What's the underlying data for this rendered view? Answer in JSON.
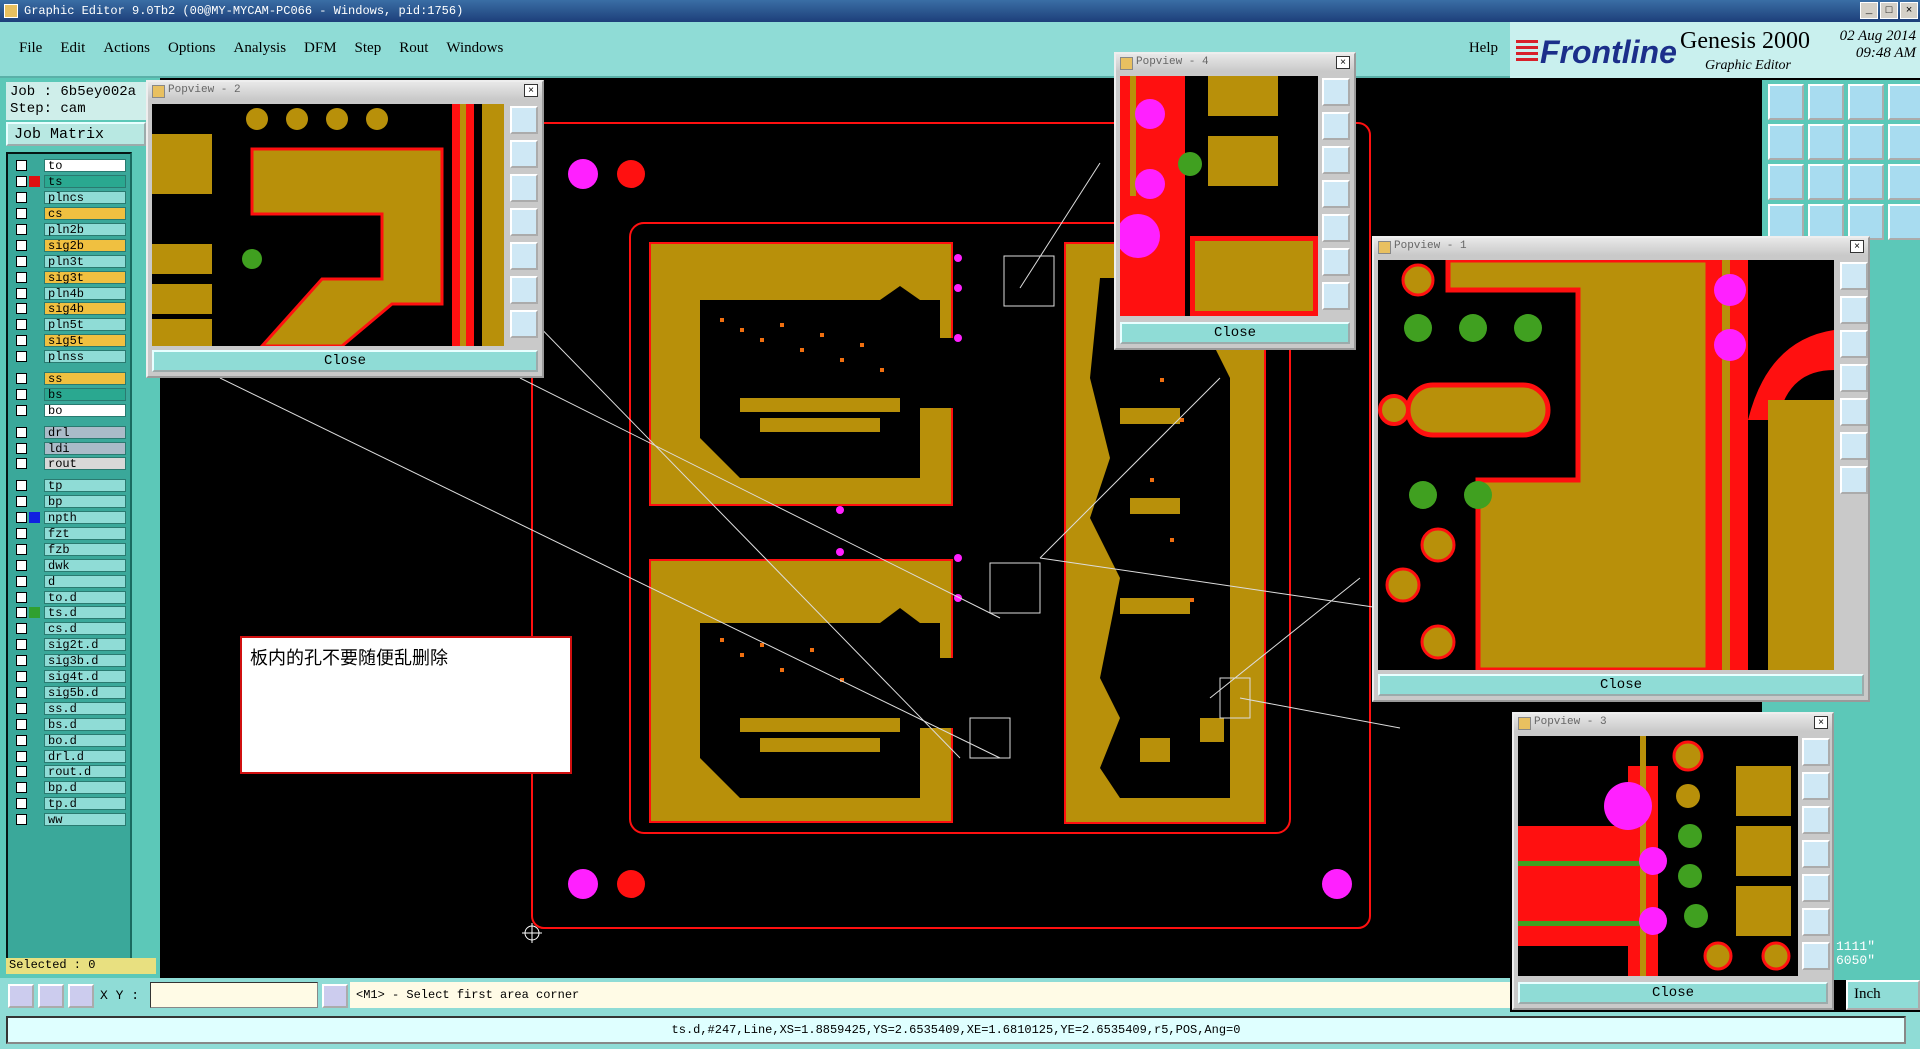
{
  "window": {
    "title": "Graphic Editor 9.0Tb2 (00@MY-MYCAM-PC066 - Windows, pid:1756)"
  },
  "menu": [
    "File",
    "Edit",
    "Actions",
    "Options",
    "Analysis",
    "DFM",
    "Step",
    "Rout",
    "Windows"
  ],
  "help": "Help",
  "brand": {
    "logo": "Frontline",
    "product": "Genesis 2000",
    "subtitle": "Graphic Editor",
    "date": "02 Aug 2014",
    "time": "09:48 AM"
  },
  "job": {
    "job_line": "Job : 6b5ey002a",
    "step_line": "Step: cam",
    "matrix_button": "Job Matrix ..."
  },
  "layers": [
    {
      "name": "to",
      "color": "#ffffff",
      "swatch": ""
    },
    {
      "name": "ts",
      "color": "#2aa890",
      "swatch": "#e01010"
    },
    {
      "name": "plncs",
      "color": "#8fdcd6",
      "swatch": ""
    },
    {
      "name": "cs",
      "color": "#f0c040",
      "swatch": ""
    },
    {
      "name": "pln2b",
      "color": "#8fdcd6",
      "swatch": ""
    },
    {
      "name": "sig2b",
      "color": "#f0c040",
      "swatch": ""
    },
    {
      "name": "pln3t",
      "color": "#8fdcd6",
      "swatch": ""
    },
    {
      "name": "sig3t",
      "color": "#f0c040",
      "swatch": ""
    },
    {
      "name": "pln4b",
      "color": "#8fdcd6",
      "swatch": ""
    },
    {
      "name": "sig4b",
      "color": "#f0c040",
      "swatch": ""
    },
    {
      "name": "pln5t",
      "color": "#8fdcd6",
      "swatch": ""
    },
    {
      "name": "sig5t",
      "color": "#f0c040",
      "swatch": ""
    },
    {
      "name": "plnss",
      "color": "#8fdcd6",
      "swatch": ""
    },
    {
      "name": "ss",
      "color": "#f0c040",
      "swatch": "",
      "gap": true
    },
    {
      "name": "bs",
      "color": "#2aa890",
      "swatch": ""
    },
    {
      "name": "bo",
      "color": "#ffffff",
      "swatch": ""
    },
    {
      "name": "drl",
      "color": "#aabbc8",
      "swatch": "",
      "gap": true
    },
    {
      "name": "ldi",
      "color": "#aabbc8",
      "swatch": ""
    },
    {
      "name": "rout",
      "color": "#d8d8d8",
      "swatch": ""
    },
    {
      "name": "tp",
      "color": "#8fdcd6",
      "swatch": "",
      "gap": true
    },
    {
      "name": "bp",
      "color": "#8fdcd6",
      "swatch": ""
    },
    {
      "name": "npth",
      "color": "#8fdcd6",
      "swatch": "#1020e0"
    },
    {
      "name": "fzt",
      "color": "#8fdcd6",
      "swatch": ""
    },
    {
      "name": "fzb",
      "color": "#8fdcd6",
      "swatch": ""
    },
    {
      "name": "dwk",
      "color": "#8fdcd6",
      "swatch": ""
    },
    {
      "name": "d",
      "color": "#8fdcd6",
      "swatch": ""
    },
    {
      "name": "to.d",
      "color": "#8fdcd6",
      "swatch": ""
    },
    {
      "name": "ts.d",
      "color": "#8fdcd6",
      "swatch": "#30a030"
    },
    {
      "name": "cs.d",
      "color": "#8fdcd6",
      "swatch": ""
    },
    {
      "name": "sig2t.d",
      "color": "#8fdcd6",
      "swatch": ""
    },
    {
      "name": "sig3b.d",
      "color": "#8fdcd6",
      "swatch": ""
    },
    {
      "name": "sig4t.d",
      "color": "#8fdcd6",
      "swatch": ""
    },
    {
      "name": "sig5b.d",
      "color": "#8fdcd6",
      "swatch": ""
    },
    {
      "name": "ss.d",
      "color": "#8fdcd6",
      "swatch": ""
    },
    {
      "name": "bs.d",
      "color": "#8fdcd6",
      "swatch": ""
    },
    {
      "name": "bo.d",
      "color": "#8fdcd6",
      "swatch": ""
    },
    {
      "name": "drl.d",
      "color": "#8fdcd6",
      "swatch": ""
    },
    {
      "name": "rout.d",
      "color": "#8fdcd6",
      "swatch": ""
    },
    {
      "name": "bp.d",
      "color": "#8fdcd6",
      "swatch": ""
    },
    {
      "name": "tp.d",
      "color": "#8fdcd6",
      "swatch": ""
    },
    {
      "name": "ww",
      "color": "#8fdcd6",
      "swatch": ""
    }
  ],
  "selected": "Selected : 0",
  "bottom": {
    "xy_label": "X Y :",
    "xy_value": "",
    "message": "<M1> - Select first area corner"
  },
  "status": "ts.d,#247,Line,XS=1.8859425,YS=2.6535409,XE=1.6810125,YE=2.6535409,r5,POS,Ang=0",
  "note": "板内的孔不要随便乱删除",
  "coords": {
    "line1": "1111\"",
    "line2": "6050\""
  },
  "unit": "Inch",
  "popups": {
    "p1": {
      "title": "Popview - 1",
      "close": "Close"
    },
    "p2": {
      "title": "Popview - 2",
      "close": "Close"
    },
    "p3": {
      "title": "Popview - 3",
      "close": "Close"
    },
    "p4": {
      "title": "Popview - 4",
      "close": "Close"
    }
  },
  "colors": {
    "copper": "#b8900a",
    "mask_red": "#ff1010",
    "drill_pink": "#ff20ff",
    "pad_green": "#40a020",
    "pad_orange": "#f07010",
    "panel": "#8fdcd6"
  }
}
